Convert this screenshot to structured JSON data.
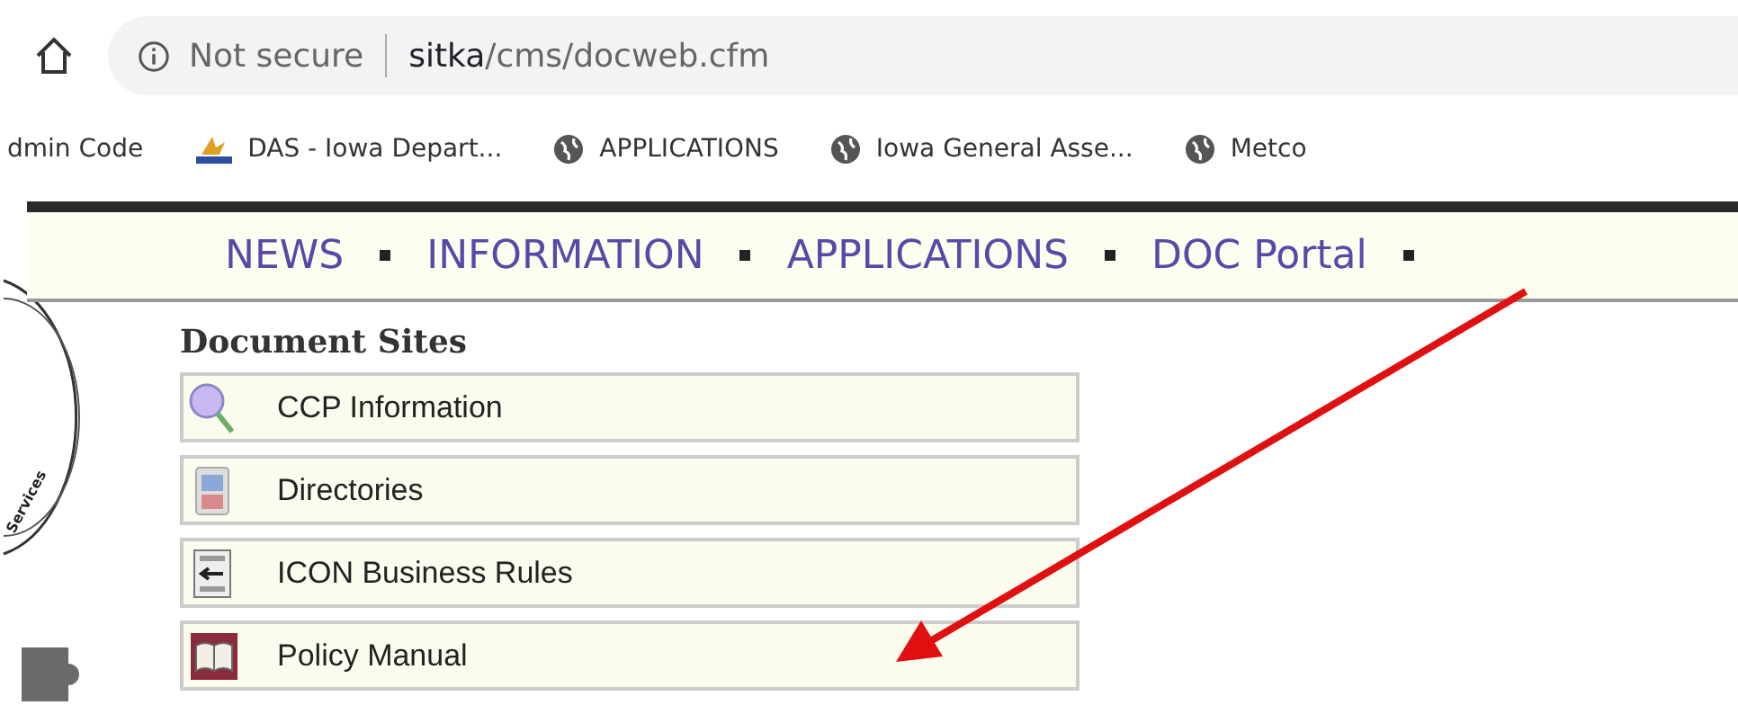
{
  "address_bar": {
    "security": "Not secure",
    "url_host": "sitka",
    "url_path": "/cms/docweb.cfm"
  },
  "bookmarks": [
    {
      "label": "dmin Code",
      "kind": "none"
    },
    {
      "label": "DAS - Iowa Depart...",
      "kind": "das"
    },
    {
      "label": "APPLICATIONS",
      "kind": "globe"
    },
    {
      "label": "Iowa General Asse...",
      "kind": "globe"
    },
    {
      "label": "Metco",
      "kind": "globe"
    }
  ],
  "seal_text": "Services",
  "nav": [
    "NEWS",
    "INFORMATION",
    "APPLICATIONS",
    "DOC Portal"
  ],
  "section_title": "Document Sites",
  "sites": [
    {
      "label": "CCP Information",
      "kind": "magnifier"
    },
    {
      "label": "Directories",
      "kind": "phone"
    },
    {
      "label": "ICON Business Rules",
      "kind": "sign"
    },
    {
      "label": "Policy Manual",
      "kind": "book"
    }
  ]
}
